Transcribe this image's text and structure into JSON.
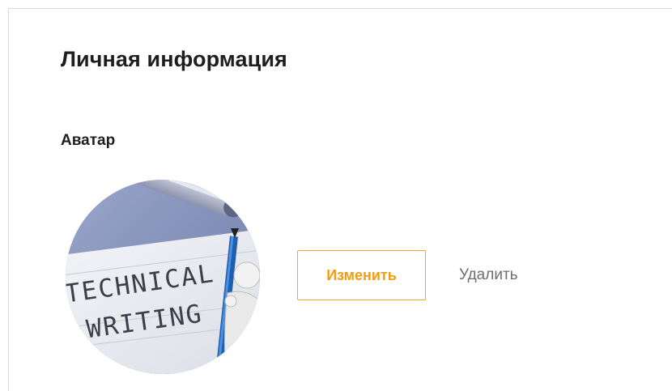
{
  "section": {
    "title": "Личная информация"
  },
  "avatar": {
    "label": "Аватар",
    "image_text_line1": "TECHNICAL",
    "image_text_line2": "WRITING"
  },
  "actions": {
    "change_label": "Изменить",
    "delete_label": "Удалить"
  },
  "colors": {
    "accent": "#f5a623",
    "text": "#1e1e1e",
    "muted": "#6e6e6e",
    "border": "#dcdcdc"
  },
  "icons": {
    "avatar_image": "technical-writing-photo"
  }
}
